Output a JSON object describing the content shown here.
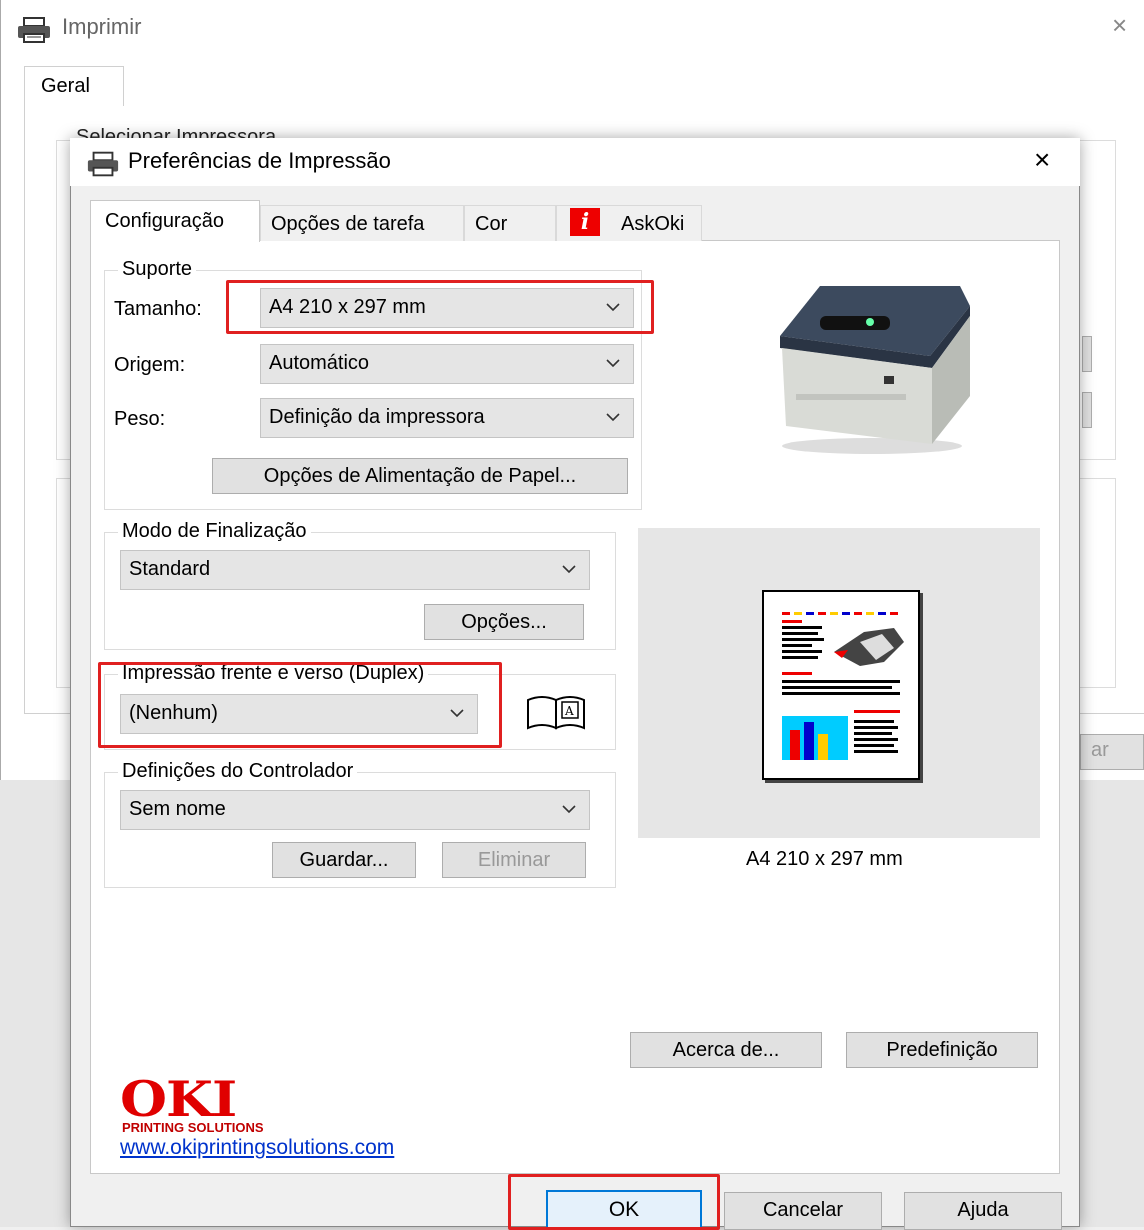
{
  "background_window": {
    "title": "Imprimir",
    "close_glyph": "×",
    "tabs": [
      "Geral"
    ],
    "section_label": "Selecionar Impressora",
    "partial_button": "ar"
  },
  "dialog": {
    "title": "Preferências de Impressão",
    "close_glyph": "×",
    "tabs": [
      {
        "label": "Configuração",
        "active": true
      },
      {
        "label": "Opções de tarefa",
        "active": false
      },
      {
        "label": "Cor",
        "active": false
      },
      {
        "label": "AskOki",
        "active": false,
        "icon": "info-i-icon"
      }
    ],
    "suporte": {
      "label": "Suporte",
      "tamanho_label": "Tamanho:",
      "tamanho_value": "A4 210 x 297 mm",
      "origem_label": "Origem:",
      "origem_value": "Automático",
      "peso_label": "Peso:",
      "peso_value": "Definição da impressora",
      "feed_button": "Opções de Alimentação de Papel..."
    },
    "finalizacao": {
      "label": "Modo de Finalização",
      "value": "Standard",
      "options_button": "Opções..."
    },
    "duplex": {
      "label": "Impressão frente e verso (Duplex)",
      "value": "(Nenhum)"
    },
    "controlador": {
      "label": "Definições do Controlador",
      "value": "Sem nome",
      "save_button": "Guardar...",
      "delete_button": "Eliminar"
    },
    "preview_caption": "A4 210 x 297 mm",
    "about_button": "Acerca de...",
    "default_button": "Predefinição",
    "brand": {
      "logo": "OKI",
      "tagline": "PRINTING SOLUTIONS",
      "url": "www.okiprintingsolutions.com"
    },
    "footer": {
      "ok": "OK",
      "cancel": "Cancelar",
      "help": "Ajuda"
    },
    "colors": {
      "highlight": "#e02020",
      "brand": "#e00000",
      "link": "#0033cc"
    }
  }
}
